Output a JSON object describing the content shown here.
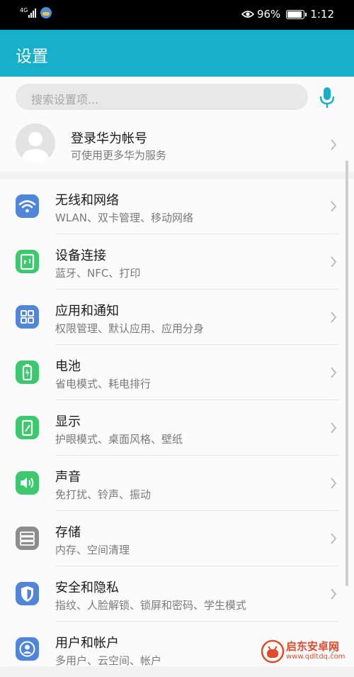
{
  "status_bar": {
    "network": "4G",
    "battery_percent": "96%",
    "battery_level": 0.96,
    "time": "1:12",
    "icons": [
      "signal-icon",
      "app-notification-icon",
      "eye-comfort-icon",
      "battery-icon"
    ]
  },
  "header": {
    "title": "设置"
  },
  "search": {
    "placeholder": "搜索设置项...",
    "icon": "microphone-icon"
  },
  "account": {
    "title": "登录华为帐号",
    "subtitle": "可使用更多华为服务",
    "icon": "avatar-icon"
  },
  "items": [
    {
      "title": "无线和网络",
      "subtitle": "WLAN、双卡管理、移动网络",
      "icon": "wifi-icon",
      "color": "#4f86d9"
    },
    {
      "title": "设备连接",
      "subtitle": "蓝牙、NFC、打印",
      "icon": "device-connect-icon",
      "color": "#3cc86c"
    },
    {
      "title": "应用和通知",
      "subtitle": "权限管理、默认应用、应用分身",
      "icon": "apps-icon",
      "color": "#4f86d9"
    },
    {
      "title": "电池",
      "subtitle": "省电模式、耗电排行",
      "icon": "battery-icon",
      "color": "#3cc86c"
    },
    {
      "title": "显示",
      "subtitle": "护眼模式、桌面风格、壁纸",
      "icon": "display-icon",
      "color": "#3cc86c"
    },
    {
      "title": "声音",
      "subtitle": "免打扰、铃声、振动",
      "icon": "sound-icon",
      "color": "#3cc86c"
    },
    {
      "title": "存储",
      "subtitle": "内存、空间清理",
      "icon": "storage-icon",
      "color": "#8d8d8d"
    },
    {
      "title": "安全和隐私",
      "subtitle": "指纹、人脸解锁、锁屏和密码、学生模式",
      "icon": "shield-icon",
      "color": "#4f86d9"
    },
    {
      "title": "用户和帐户",
      "subtitle": "多用户、云空间、帐户",
      "icon": "user-icon",
      "color": "#4f86d9"
    }
  ],
  "watermark": {
    "name": "启东安卓网",
    "url": "www.qdltdq.com"
  }
}
